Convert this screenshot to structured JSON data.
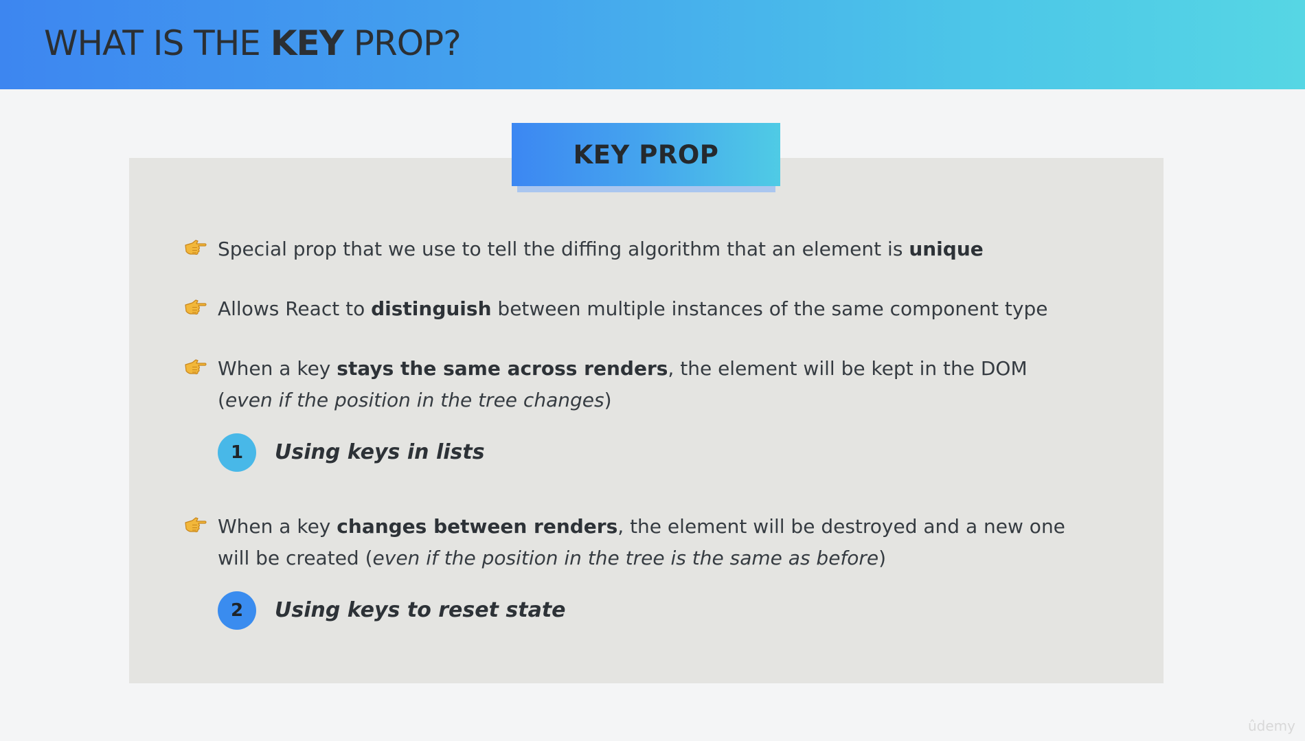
{
  "slide": {
    "title_pre": "WHAT IS THE ",
    "title_key": "KEY",
    "title_post": " PROP?",
    "badge_label": "KEY PROP"
  },
  "bullets": [
    {
      "icon": "pointing-hand-icon",
      "parts": [
        {
          "text": "Special prop that we use to tell the diffing algorithm that an element is "
        },
        {
          "text": "unique",
          "bold": true
        }
      ]
    },
    {
      "icon": "pointing-hand-icon",
      "parts": [
        {
          "text": "Allows React to "
        },
        {
          "text": "distinguish",
          "bold": true
        },
        {
          "text": " between multiple instances of the same component type"
        }
      ]
    },
    {
      "icon": "pointing-hand-icon",
      "parts": [
        {
          "text": "When a key "
        },
        {
          "text": "stays the same across renders",
          "bold": true
        },
        {
          "text": ", the element will be kept in the DOM"
        },
        {
          "br": true
        },
        {
          "text": "("
        },
        {
          "text": "even if the position in the tree changes",
          "italic": true
        },
        {
          "text": ")"
        }
      ]
    },
    {
      "icon": "pointing-hand-icon",
      "parts": [
        {
          "text": "When a key "
        },
        {
          "text": "changes between renders",
          "bold": true
        },
        {
          "text": ", the element will be destroyed and a new one"
        },
        {
          "br": true
        },
        {
          "text": "will be created ("
        },
        {
          "text": "even if the position in the tree is the same as before",
          "italic": true
        },
        {
          "text": ")"
        }
      ]
    }
  ],
  "steps": [
    {
      "number": "1",
      "label": "Using keys in lists",
      "color": "#48b8e8"
    },
    {
      "number": "2",
      "label": "Using keys to reset state",
      "color": "#3a8cef"
    }
  ],
  "watermark": "ûdemy",
  "colors": {
    "header_gradient_start": "#3d86f0",
    "header_gradient_end": "#56d6e4",
    "panel": "#e4e4e1",
    "background": "#f4f5f6",
    "hand": "#f2b73a"
  }
}
